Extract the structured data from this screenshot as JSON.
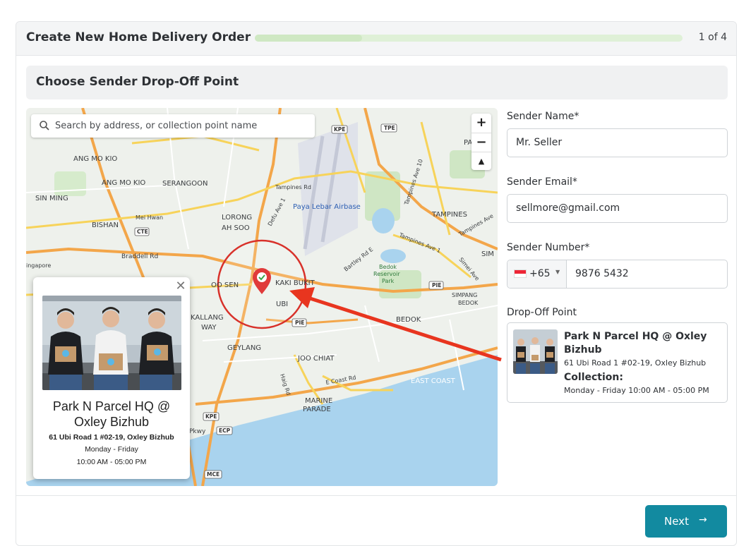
{
  "header": {
    "title": "Create New Home Delivery Order",
    "step": "1 of 4",
    "progress_fraction": 0.25
  },
  "section": {
    "title": "Choose Sender Drop-Off Point"
  },
  "map": {
    "search_placeholder": "Search by address, or collection point name",
    "zoom_in": "+",
    "zoom_out": "−",
    "compass": "▲",
    "labels": {
      "ang_mo_kio_top": "ANG MO KIO",
      "ang_mo_kio": "ANG MO KIO",
      "serangoon": "SERANGOON",
      "sin_ming": "SIN MING",
      "bishan": "BISHAN",
      "mei_hwan": "Mei Hwan",
      "cte": "CTE",
      "lorong_ah_soo_1": "LORONG",
      "lorong_ah_soo_2": "AH SOO",
      "braddell": "Braddell Rd",
      "singapore": "ingapore",
      "tampines_rd": "Tampines Rd",
      "defu_ave": "Defu Ave 1",
      "paya_lebar": "Paya Lebar Airbase",
      "tampines_ave10": "Tampines Ave 10",
      "tampines": "TAMPINES",
      "tampines_ave_right": "Tampines Ave",
      "tampines_ave1": "Tampines Ave 1",
      "bartley": "Bartley Rd E",
      "bedok_reservoir_1": "Bedok",
      "bedok_reservoir_2": "Reservoir",
      "bedok_reservoir_3": "Park",
      "pie_right": "PIE",
      "simpang_1": "SIMPANG",
      "simpang_2": "BEDOK",
      "simei": "Simei Ave",
      "sim": "SIM",
      "kaki_bukit": "KAKI BUKIT",
      "oo_sen": "OO SEN",
      "ubi": "UBI",
      "pie_mid": "PIE",
      "bedok": "BEDOK",
      "kallang_1": "KALLANG",
      "kallang_2": "WAY",
      "geylang": "GEYLANG",
      "joo_chiat": "JOO CHIAT",
      "haig_rd": "Haig Rd",
      "ecoast_rd": "E Coast Rd",
      "east_coast": "EAST COAST",
      "marine_1": "MARINE",
      "marine_2": "PARADE",
      "kpe_top": "KPE",
      "tpe": "TPE",
      "kpe_bottom": "KPE",
      "pkwy": "Pkwy",
      "ecp": "ECP",
      "mce": "MCE",
      "pa_r": "PA  R"
    },
    "popup": {
      "close": "✕",
      "name": "Park N Parcel HQ @ Oxley Bizhub",
      "address": "61 Ubi Road 1 #02-19, Oxley Bizhub",
      "days": "Monday - Friday",
      "hours": "10:00 AM - 05:00 PM"
    }
  },
  "form": {
    "sender_name_label": "Sender Name*",
    "sender_name_value": "Mr. Seller",
    "sender_email_label": "Sender Email*",
    "sender_email_value": "sellmore@gmail.com",
    "sender_number_label": "Sender Number*",
    "country_code": "+65",
    "phone_value": "9876 5432",
    "dropoff_label": "Drop-Off Point",
    "dropoff": {
      "name": "Park N Parcel HQ @ Oxley Bizhub",
      "address": "61 Ubi Road 1 #02-19, Oxley Bizhub",
      "collection_label": "Collection:",
      "hours": "Monday - Friday 10:00 AM - 05:00 PM"
    }
  },
  "footer": {
    "next_label": "Next",
    "next_arrow": "→"
  },
  "colors": {
    "accent": "#128aa0",
    "progress": "#dff0d7",
    "arrow": "#e8351f",
    "pin": "#e03a3a"
  }
}
